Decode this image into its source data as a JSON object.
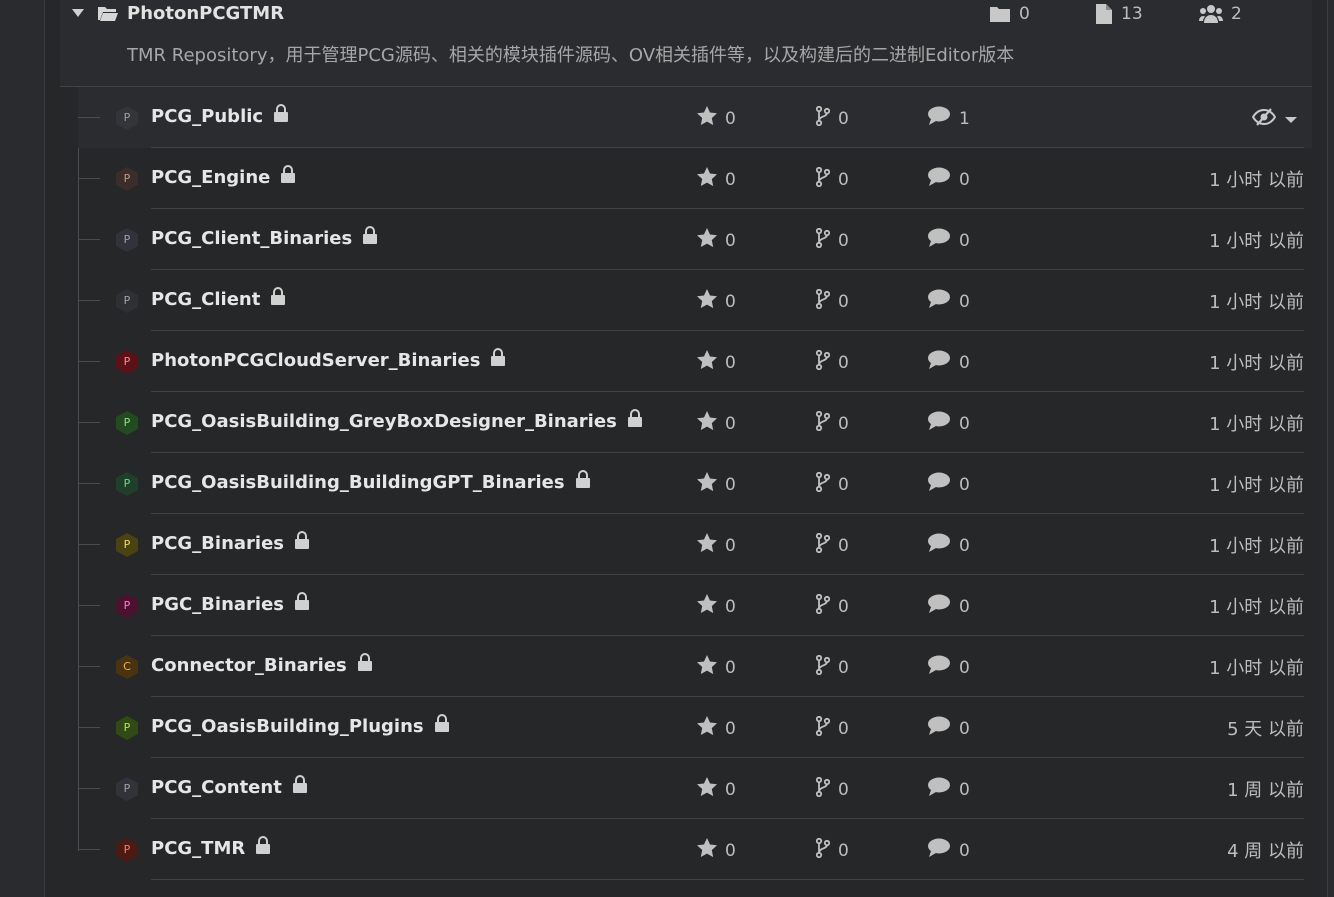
{
  "group": {
    "name": "PhotonPCGTMR",
    "description": "TMR Repository，用于管理PCG源码、相关的模块插件源码、OV相关插件等，以及构建后的二进制Editor版本",
    "folder_count": "0",
    "file_count": "13",
    "member_count": "2"
  },
  "icons": {
    "caret": "caret-down-icon",
    "group": "folder-open-icon",
    "folders": "folder-icon",
    "files": "file-icon",
    "members": "users-icon",
    "lock": "lock-icon",
    "star": "star-icon",
    "fork": "fork-icon",
    "comment": "comment-icon",
    "watch": "eye-slash-icon",
    "dropdown": "chevron-down-icon"
  },
  "colors": {
    "text_primary": "#e6e6e6",
    "text_secondary": "#bdbdbd",
    "separator": "#404246"
  },
  "repos": [
    {
      "name": "PCG_Public",
      "initial": "P",
      "avatar_bg": "#33353a",
      "avatar_fg": "#9ea2a8",
      "stars": "0",
      "forks": "0",
      "issues": "1",
      "updated": ""
    },
    {
      "name": "PCG_Engine",
      "initial": "P",
      "avatar_bg": "#3a2d2a",
      "avatar_fg": "#c59a86",
      "stars": "0",
      "forks": "0",
      "issues": "0",
      "updated": "1 小时 以前"
    },
    {
      "name": "PCG_Client_Binaries",
      "initial": "P",
      "avatar_bg": "#30333a",
      "avatar_fg": "#9ea2a8",
      "stars": "0",
      "forks": "0",
      "issues": "0",
      "updated": "1 小时 以前"
    },
    {
      "name": "PCG_Client",
      "initial": "P",
      "avatar_bg": "#2e3033",
      "avatar_fg": "#9ea2a8",
      "stars": "0",
      "forks": "0",
      "issues": "0",
      "updated": "1 小时 以前"
    },
    {
      "name": "PhotonPCGCloudServer_Binaries",
      "initial": "P",
      "avatar_bg": "#5a1117",
      "avatar_fg": "#ff8a8a",
      "stars": "0",
      "forks": "0",
      "issues": "0",
      "updated": "1 小时 以前"
    },
    {
      "name": "PCG_OasisBuilding_GreyBoxDesigner_Binaries",
      "initial": "P",
      "avatar_bg": "#244a22",
      "avatar_fg": "#8fe07f",
      "stars": "0",
      "forks": "0",
      "issues": "0",
      "updated": "1 小时 以前"
    },
    {
      "name": "PCG_OasisBuilding_BuildingGPT_Binaries",
      "initial": "P",
      "avatar_bg": "#1f3f2a",
      "avatar_fg": "#74d197",
      "stars": "0",
      "forks": "0",
      "issues": "0",
      "updated": "1 小时 以前"
    },
    {
      "name": "PCG_Binaries",
      "initial": "P",
      "avatar_bg": "#4a4210",
      "avatar_fg": "#f2de5a",
      "stars": "0",
      "forks": "0",
      "issues": "0",
      "updated": "1 小时 以前"
    },
    {
      "name": "PGC_Binaries",
      "initial": "P",
      "avatar_bg": "#4b1230",
      "avatar_fg": "#ff7cc0",
      "stars": "0",
      "forks": "0",
      "issues": "0",
      "updated": "1 小时 以前"
    },
    {
      "name": "Connector_Binaries",
      "initial": "C",
      "avatar_bg": "#4a3410",
      "avatar_fg": "#f0b049",
      "stars": "0",
      "forks": "0",
      "issues": "0",
      "updated": "1 小时 以前"
    },
    {
      "name": "PCG_OasisBuilding_Plugins",
      "initial": "P",
      "avatar_bg": "#2f4a12",
      "avatar_fg": "#b3e461",
      "stars": "0",
      "forks": "0",
      "issues": "0",
      "updated": "5 天 以前"
    },
    {
      "name": "PCG_Content",
      "initial": "P",
      "avatar_bg": "#30333a",
      "avatar_fg": "#9ea2a8",
      "stars": "0",
      "forks": "0",
      "issues": "0",
      "updated": "1 周 以前"
    },
    {
      "name": "PCG_TMR",
      "initial": "P",
      "avatar_bg": "#4a1a15",
      "avatar_fg": "#ff7b6b",
      "stars": "0",
      "forks": "0",
      "issues": "0",
      "updated": "4 周 以前"
    }
  ]
}
